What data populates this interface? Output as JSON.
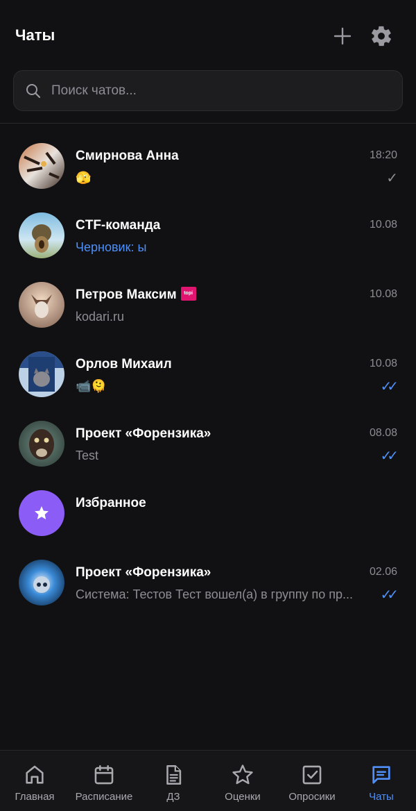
{
  "header": {
    "title": "Чаты",
    "add_icon": "plus-icon",
    "settings_icon": "gear-icon"
  },
  "search": {
    "placeholder": "Поиск чатов...",
    "icon": "search-icon"
  },
  "chats": [
    {
      "name": "Смирнова Анна",
      "time": "18:20",
      "preview": "🫣",
      "status": "sent",
      "check": "✓"
    },
    {
      "name": "CTF-команда",
      "time": "10.08",
      "preview": "Черновик: ы",
      "status": "",
      "check": ""
    },
    {
      "name": "Петров Максим",
      "time": "10.08",
      "preview": "kodari.ru",
      "status": "",
      "check": "",
      "badge": "topi"
    },
    {
      "name": "Орлов Михаил",
      "time": "10.08",
      "preview": "📹🫠",
      "status": "read",
      "check": "✓✓"
    },
    {
      "name": "Проект «Форензика»",
      "time": "08.08",
      "preview": "Test",
      "status": "read",
      "check": "✓✓"
    },
    {
      "name": "Избранное",
      "time": "",
      "preview": "",
      "status": "",
      "check": ""
    },
    {
      "name": "Проект «Форензика»",
      "time": "02.06",
      "preview": "Система: Тестов Тест вошел(а) в группу по пр...",
      "status": "read",
      "check": "✓✓"
    }
  ],
  "nav": [
    {
      "label": "Главная",
      "icon": "home-icon"
    },
    {
      "label": "Расписание",
      "icon": "calendar-icon"
    },
    {
      "label": "ДЗ",
      "icon": "document-icon"
    },
    {
      "label": "Оценки",
      "icon": "star-icon"
    },
    {
      "label": "Опросики",
      "icon": "checkbox-icon"
    },
    {
      "label": "Чаты",
      "icon": "chat-icon",
      "active": true
    }
  ],
  "colors": {
    "background": "#111113",
    "accent": "#4f8ff7",
    "favorites_avatar": "#8b5cf6",
    "muted_text": "#8d8d93"
  }
}
